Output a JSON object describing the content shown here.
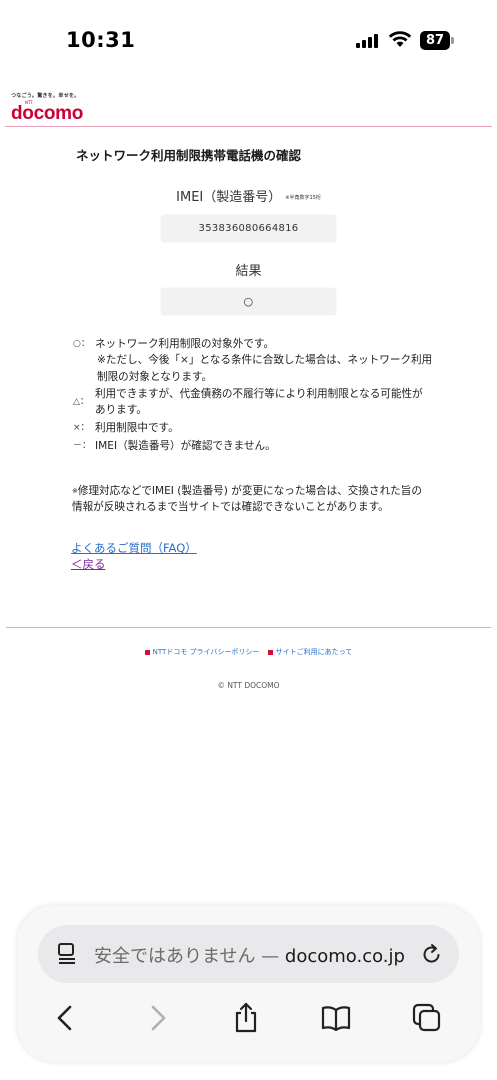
{
  "status_bar": {
    "time": "10:31",
    "battery": "87"
  },
  "brand": {
    "tagline": "つなごう。驚きを。幸せを。",
    "ntt": "NTT",
    "logo": "docomo"
  },
  "page": {
    "title": "ネットワーク利用制限携帯電話機の確認",
    "imei_label": "IMEI（製造番号）",
    "imei_note": "※半角数字15桁",
    "imei_value": "353836080664816",
    "result_label": "結果",
    "result_value": "○"
  },
  "legend": [
    {
      "symbol": "○：",
      "text": "ネットワーク利用制限の対象外です。"
    },
    {
      "symbol": "",
      "text": "※ただし、今後「×」となる条件に合致した場合は、ネットワーク利用制限の対象となります。"
    },
    {
      "symbol": "△：",
      "text": "利用できますが、代金債務の不履行等により利用制限となる可能性があります。"
    },
    {
      "symbol": "×：",
      "text": "利用制限中です。"
    },
    {
      "symbol": "－：",
      "text": "IMEI（製造番号）が確認できません。"
    }
  ],
  "note": {
    "mark": "※",
    "line1": "修理対応などでIMEI (製造番号) が変更になった場合は、交換された旨の情報が反映されるまで当サイトでは確認できないことがあります。"
  },
  "links": {
    "faq": "よくあるご質問（FAQ）",
    "back": "＜戻る"
  },
  "footer": {
    "links": [
      "NTTドコモ プライバシーポリシー",
      "サイトご利用にあたって"
    ],
    "copyright": "© NTT DOCOMO"
  },
  "browser": {
    "url_prefix": "安全ではありません — ",
    "url_domain": "docomo.co.jp"
  },
  "colors": {
    "brand": "#cc0033",
    "link": "#2a6fc7",
    "visited": "#7a2a9a"
  }
}
